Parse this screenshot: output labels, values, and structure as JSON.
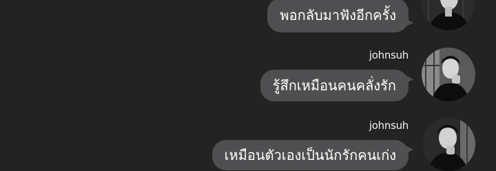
{
  "messages": [
    {
      "username": "",
      "text": "พอกลับมาฟังอีกครั้ง",
      "avatar_icon": "user-photo-avatar-icon"
    },
    {
      "username": "johnsuh",
      "text": "รู้สึกเหมือนคนคลั่งรัก",
      "avatar_icon": "user-photo-avatar-icon"
    },
    {
      "username": "johnsuh",
      "text": "เหมือนตัวเองเป็นนักรักคนเก่ง",
      "avatar_icon": "user-photo-avatar-icon"
    }
  ],
  "colors": {
    "background": "#232324",
    "bubble": "#4f4f51",
    "text": "#ffffff"
  }
}
